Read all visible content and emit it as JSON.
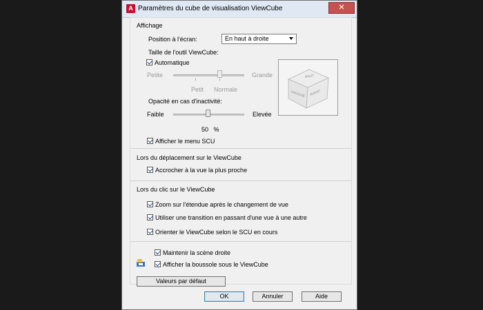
{
  "window": {
    "title": "Paramètres du cube de visualisation ViewCube",
    "close_glyph": "✕",
    "app_icon_letter": "A"
  },
  "display": {
    "section_title": "Affichage",
    "position_label": "Position à l'écran:",
    "position_value": "En haut à droite",
    "size_label": "Taille de l'outil ViewCube:",
    "automatic_label": "Automatique",
    "automatic_checked": true,
    "size_min_label": "Petite",
    "size_max_label": "Grande",
    "size_tick_small": "Petit",
    "size_tick_normal": "Normale",
    "opacity_label": "Opacité en cas d'inactivité:",
    "opacity_min_label": "Faible",
    "opacity_max_label": "Elevée",
    "opacity_value": "50",
    "opacity_unit": "%",
    "show_ucs_menu_label": "Afficher le menu SCU",
    "show_ucs_menu_checked": true
  },
  "preview_cube": {
    "top_face": "HAUT",
    "left_face": "GAUCHE",
    "right_face": "AVANT"
  },
  "drag": {
    "section_title": "Lors du déplacement sur le ViewCube",
    "snap_label": "Accrocher à la vue la plus proche",
    "snap_checked": true
  },
  "click": {
    "section_title": "Lors du clic sur le ViewCube",
    "zoom_label": "Zoom sur l'étendue après le changement de vue",
    "zoom_checked": true,
    "transition_label": "Utiliser une transition en passant d'une vue à une autre",
    "transition_checked": true,
    "orient_label": "Orienter le ViewCube selon le SCU en cours",
    "orient_checked": true
  },
  "bottom": {
    "keep_upright_label": "Maintenir la scène droite",
    "keep_upright_checked": true,
    "show_compass_label": "Afficher la boussole sous le ViewCube",
    "show_compass_checked": true,
    "defaults_button": "Valeurs par défaut"
  },
  "buttons": {
    "ok": "OK",
    "cancel": "Annuler",
    "help": "Aide"
  },
  "colors": {
    "dialog_bg": "#f0f0f0",
    "close_red": "#c75050",
    "check_blue": "#1d3f8a"
  }
}
